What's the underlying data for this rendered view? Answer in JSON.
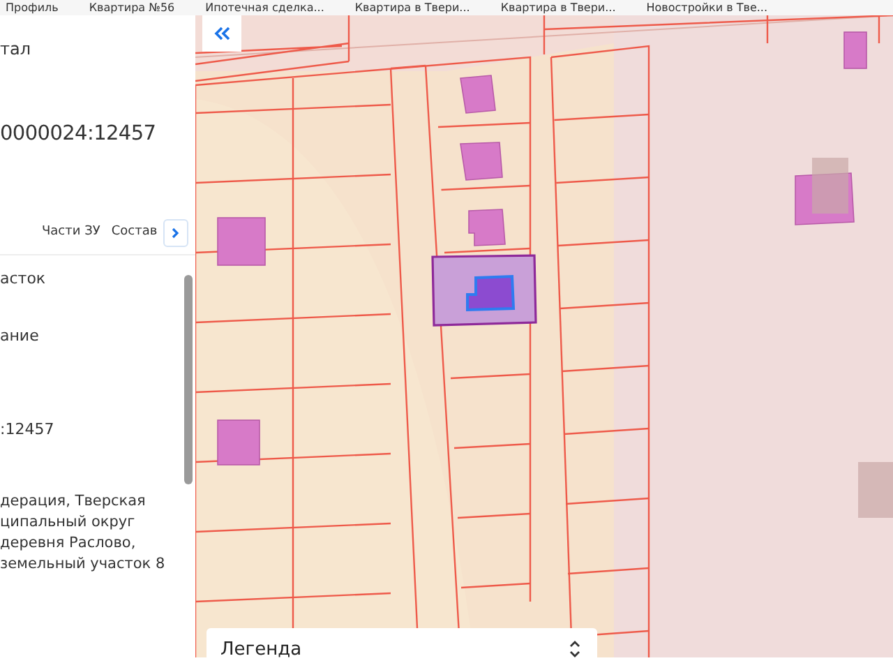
{
  "bookmarks": [
    "Профиль",
    "Квартира №56",
    "Ипотечная сделка...",
    "Квартира в Твери...",
    "Квартира в Твери...",
    "Новостройки в Тве..."
  ],
  "panel": {
    "heading": "тал",
    "cadastral_number": "0000024:12457",
    "tabs": [
      {
        "label": "Части ЗУ",
        "selected": false
      },
      {
        "label": "Состав",
        "selected": false
      }
    ],
    "fields": [
      {
        "kind": "value",
        "text": "асток"
      },
      {
        "kind": "value",
        "text": "ание"
      },
      {
        "kind": "value",
        "text": ":12457"
      },
      {
        "kind": "address",
        "text": "дерация, Тверская ципальный округ деревня Раслово, земельный участок 8"
      }
    ]
  },
  "map": {
    "legend": "Легенда"
  }
}
